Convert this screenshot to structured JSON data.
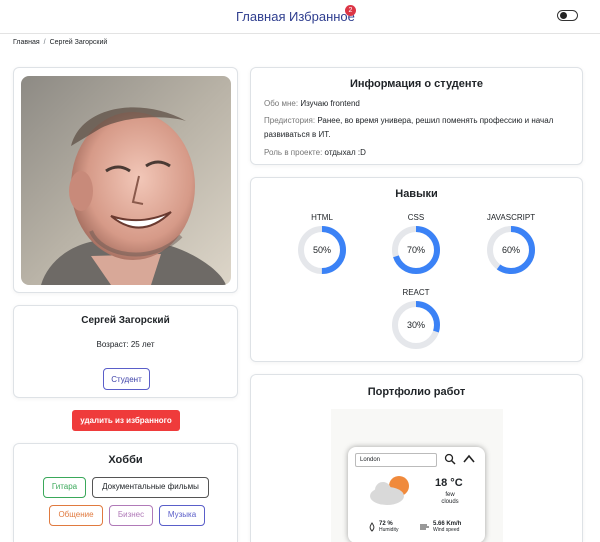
{
  "nav": {
    "home": "Главная",
    "favorites": "Избранное",
    "favorites_count": "2",
    "theme_toggle_icon": "toggle-switch-icon"
  },
  "breadcrumb": {
    "home": "Главная",
    "separator": "/",
    "current": "Сергей Загорский"
  },
  "profile": {
    "name": "Сергей Загорский",
    "age": "Возраст: 25 лет",
    "role_button": "Студент",
    "remove_favorite_button": "удалить из избранного",
    "photo_icon": "student-portrait-photo"
  },
  "hobbies": {
    "title": "Хобби",
    "items": [
      {
        "label": "Гитара",
        "color": "#3aa85a"
      },
      {
        "label": "Документальные фильмы",
        "color": "#555555"
      },
      {
        "label": "Общение",
        "color": "#e07a3f"
      },
      {
        "label": "Бизнес",
        "color": "#b07ab8"
      },
      {
        "label": "Музыка",
        "color": "#5a5ec9"
      }
    ]
  },
  "info": {
    "title": "Информация о студенте",
    "about_label": "Обо мне:",
    "about_value": "Изучаю frontend",
    "history_label": "Предистория:",
    "history_value_line1": "Ранее, во время универа, решил поменять профессию и начал",
    "history_value_line2": "развиваться в ИТ.",
    "role_label": "Роль в проекте:",
    "role_value": "отдыхал :D"
  },
  "skills": {
    "title": "Навыки",
    "accent_color": "#3b82f6",
    "track_color": "#e5e7eb",
    "items": [
      {
        "name": "HTML",
        "percent": 50,
        "label": "50%"
      },
      {
        "name": "CSS",
        "percent": 70,
        "label": "70%"
      },
      {
        "name": "JAVASCRIPT",
        "percent": 60,
        "label": "60%"
      },
      {
        "name": "REACT",
        "percent": 30,
        "label": "30%"
      }
    ]
  },
  "portfolio": {
    "title": "Портфолио работ",
    "weather": {
      "city": "London",
      "temperature": "18 °C",
      "description_line1": "few",
      "description_line2": "clouds",
      "humidity_value": "72 %",
      "humidity_label": "Humidity",
      "wind_value": "5.66 Km/h",
      "wind_label": "Wind speed",
      "search_icon": "magnifier-icon",
      "collapse_icon": "chevron-up-icon"
    }
  }
}
